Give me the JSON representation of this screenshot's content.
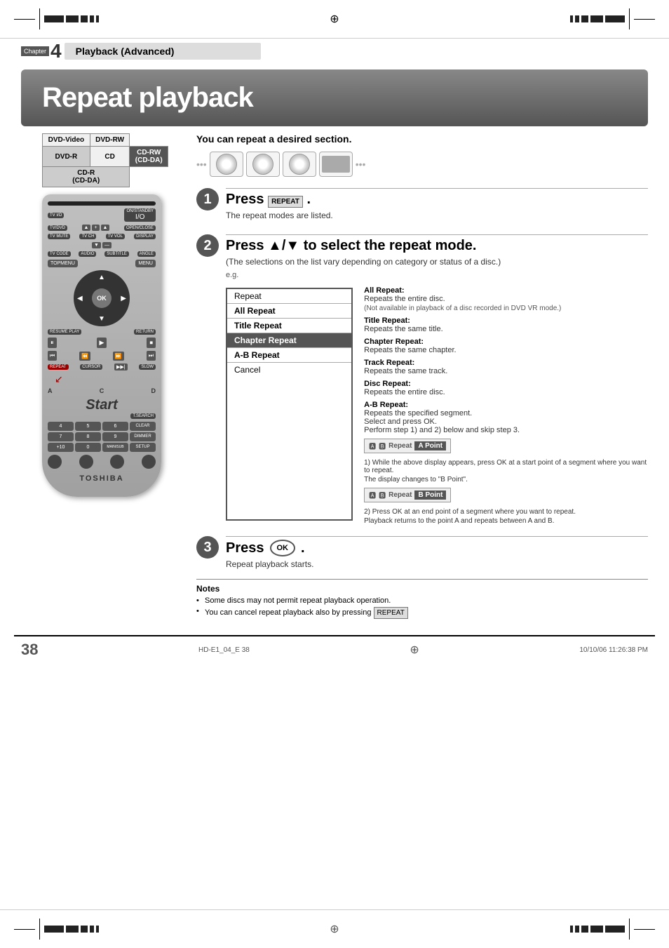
{
  "page": {
    "number": "38",
    "footer_left": "HD-E1_04_E  38",
    "footer_right": "10/10/06   11:26:38 PM"
  },
  "chapter": {
    "label": "Chapter",
    "number": "4",
    "title": "Playback (Advanced)"
  },
  "main_title": "Repeat playback",
  "subtitle": "You can repeat a desired section.",
  "disc_types": {
    "rows": [
      [
        "DVD-Video",
        "DVD-RW"
      ],
      [
        "DVD-R",
        "CD",
        "CD-RW\n(CD-DA)"
      ],
      [
        "CD-R\n(CD-DA)",
        "",
        ""
      ]
    ]
  },
  "steps": {
    "step1": {
      "number": "1",
      "title": "Press",
      "button_label": "REPEAT",
      "description": "The repeat modes are listed."
    },
    "step2": {
      "number": "2",
      "title": "Press ▲/▼ to select the repeat mode.",
      "note": "(The selections on the list vary depending on category or status of a disc.)",
      "eg_label": "e.g.",
      "menu_items": [
        {
          "label": "Repeat",
          "style": "normal"
        },
        {
          "label": "All Repeat",
          "style": "bold"
        },
        {
          "label": "Title Repeat",
          "style": "bold"
        },
        {
          "label": "Chapter Repeat",
          "style": "highlight"
        },
        {
          "label": "A-B Repeat",
          "style": "bold"
        },
        {
          "label": "Cancel",
          "style": "normal"
        }
      ],
      "descriptions": [
        {
          "title": "All Repeat:",
          "text": "Repeats the entire disc.",
          "note": "(Not available in playback of a disc recorded in DVD VR mode.)"
        },
        {
          "title": "Title Repeat:",
          "text": "Repeats the same title."
        },
        {
          "title": "Chapter Repeat:",
          "text": "Repeats the same chapter."
        },
        {
          "title": "Track Repeat:",
          "text": "Repeats the same track."
        },
        {
          "title": "Disc Repeat:",
          "text": "Repeats the entire disc."
        },
        {
          "title": "A-B Repeat:",
          "text": "Repeats the specified segment.\nSelect and press OK.\nPerform step 1) and 2) below and skip step 3."
        }
      ],
      "ab_point1_label": "A Point",
      "ab_point2_label": "B Point",
      "ab_step1": "1) While the above display appears, press OK at a start point of a segment where you want to repeat.",
      "ab_display_change": "The display changes to \"B Point\".",
      "ab_step2": "2) Press OK at an end point of a segment where you want to repeat.",
      "ab_result": "Playback returns to the point A and repeats between A and B."
    },
    "step3": {
      "number": "3",
      "title": "Press",
      "button_label": "OK",
      "description": "Repeat playback starts."
    }
  },
  "notes": {
    "title": "Notes",
    "items": [
      "Some discs may not permit repeat playback operation.",
      "You can cancel repeat playback also by pressing"
    ]
  },
  "remote": {
    "brand": "TOSHIBA",
    "start_label": "Start",
    "buttons": {
      "tv_io": "TV I/O",
      "on_standby": "ON/STANDBY",
      "tv_dvd": "TV/DVD",
      "open_close": "OPEN/CLOSE",
      "tv_mute": "TV MUTE",
      "tv_ch": "TV CH",
      "tv_vol": "TV VOL",
      "display": "DISPLAY",
      "tv_code": "TV CODE",
      "audio": "AUDIO",
      "subtitle": "SUBTITLE",
      "angle": "ANGLE",
      "top_menu": "TOPMENU",
      "menu": "MENU",
      "ok": "OK",
      "resume_play": "RESUME PLAY",
      "return": "RETURN",
      "repeat": "REPEAT",
      "cursor": "CURSOR",
      "slow": "SLOW",
      "t_search": "T.SEARCH",
      "clear": "CLEAR",
      "dimmer": "DIMMER",
      "main_sub": "MAIN/SUB",
      "setup": "SETUP"
    }
  }
}
